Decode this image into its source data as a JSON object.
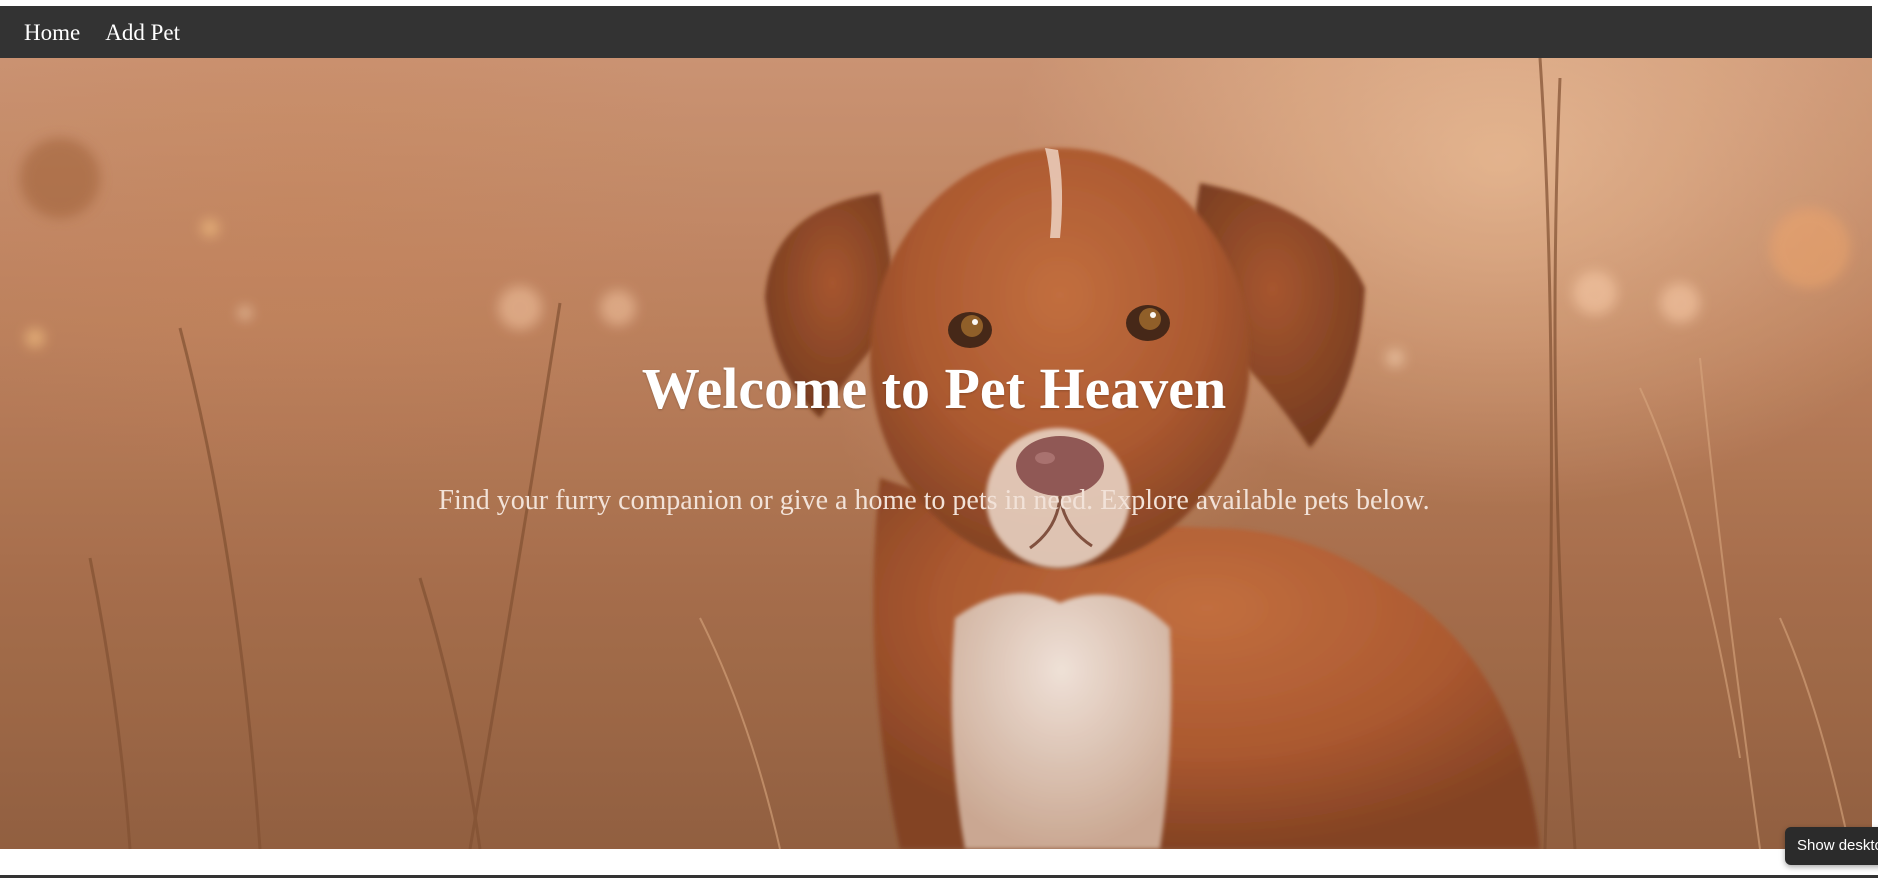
{
  "nav": {
    "items": [
      {
        "label": "Home"
      },
      {
        "label": "Add Pet"
      }
    ]
  },
  "hero": {
    "title": "Welcome to Pet Heaven",
    "subtitle": "Find your furry companion or give a home to pets in need. Explore available pets below.",
    "image_subject": "dog-photo"
  },
  "tooltip": {
    "label": "Show deskto"
  },
  "colors": {
    "navbar_bg": "#333333",
    "nav_text": "#ffffff",
    "hero_title": "#ffffff",
    "hero_subtitle": "#f2e2d8",
    "dog_fur": "#a8532a"
  }
}
